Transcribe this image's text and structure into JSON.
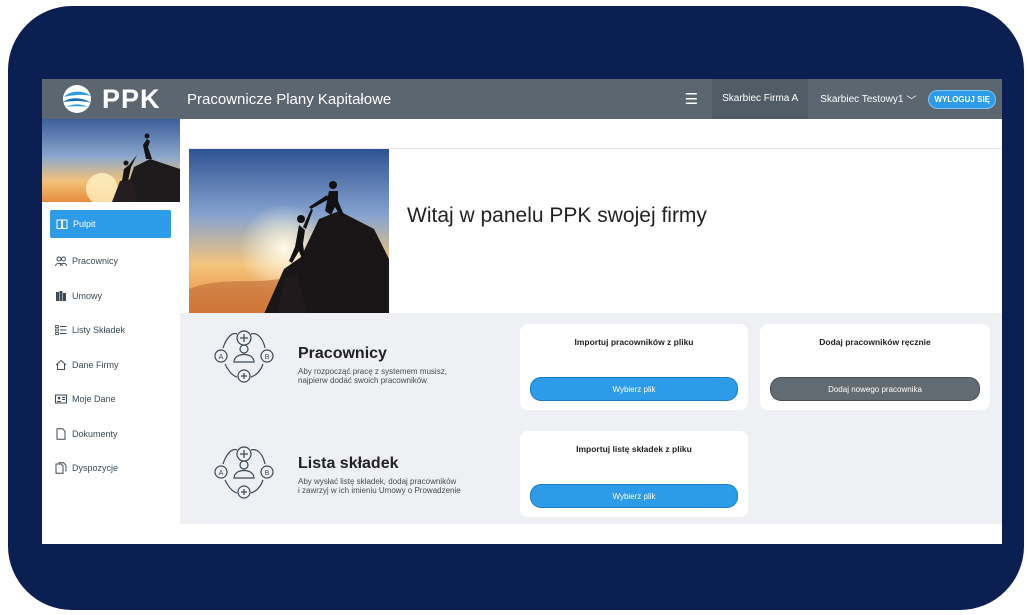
{
  "header": {
    "logo_text": "PPK",
    "title": "Pracownicze Plany Kapitałowe",
    "menu_icon": "hamburger-icon",
    "context_company": "Skarbiec Firma A",
    "context_user": "Skarbiec Testowy1",
    "user_chevron": "﹀",
    "logout_label": "WYLOGUJ SIĘ"
  },
  "sidebar": {
    "items": [
      {
        "label": "Pulpit",
        "icon": "book-icon",
        "active": true
      },
      {
        "label": "Pracownicy",
        "icon": "users-icon",
        "active": false
      },
      {
        "label": "Umowy",
        "icon": "documents-icon",
        "active": false
      },
      {
        "label": "Listy Składek",
        "icon": "list-icon",
        "active": false
      },
      {
        "label": "Dane Firmy",
        "icon": "home-icon",
        "active": false
      },
      {
        "label": "Moje Dane",
        "icon": "id-card-icon",
        "active": false
      },
      {
        "label": "Dokumenty",
        "icon": "file-icon",
        "active": false
      },
      {
        "label": "Dyspozycje",
        "icon": "files-icon",
        "active": false
      }
    ]
  },
  "main": {
    "welcome": "Witaj w panelu PPK swojej firmy",
    "sections": {
      "employees": {
        "title": "Pracownicy",
        "desc_line1": "Aby rozpocząć pracę z systemem musisz,",
        "desc_line2": "najpierw dodać swoich pracowników",
        "import_card_title": "Importuj pracowników z pliku",
        "import_button": "Wybierz plik",
        "manual_card_title": "Dodaj pracowników ręcznie",
        "manual_button": "Dodaj nowego pracownika"
      },
      "contributions": {
        "title": "Lista składek",
        "desc_line1": "Aby wysłać listę składek, dodaj pracowników",
        "desc_line2": "i zawrzyj w ich imieniu Umowy o Prowadzenie",
        "import_card_title": "Importuj listę składek z pliku",
        "import_button": "Wybierz plik"
      }
    }
  },
  "colors": {
    "frame": "#0b1f52",
    "topbar": "#5b6670",
    "accent": "#2d9be8",
    "panel": "#eef0f3",
    "gray_button": "#626b72"
  }
}
